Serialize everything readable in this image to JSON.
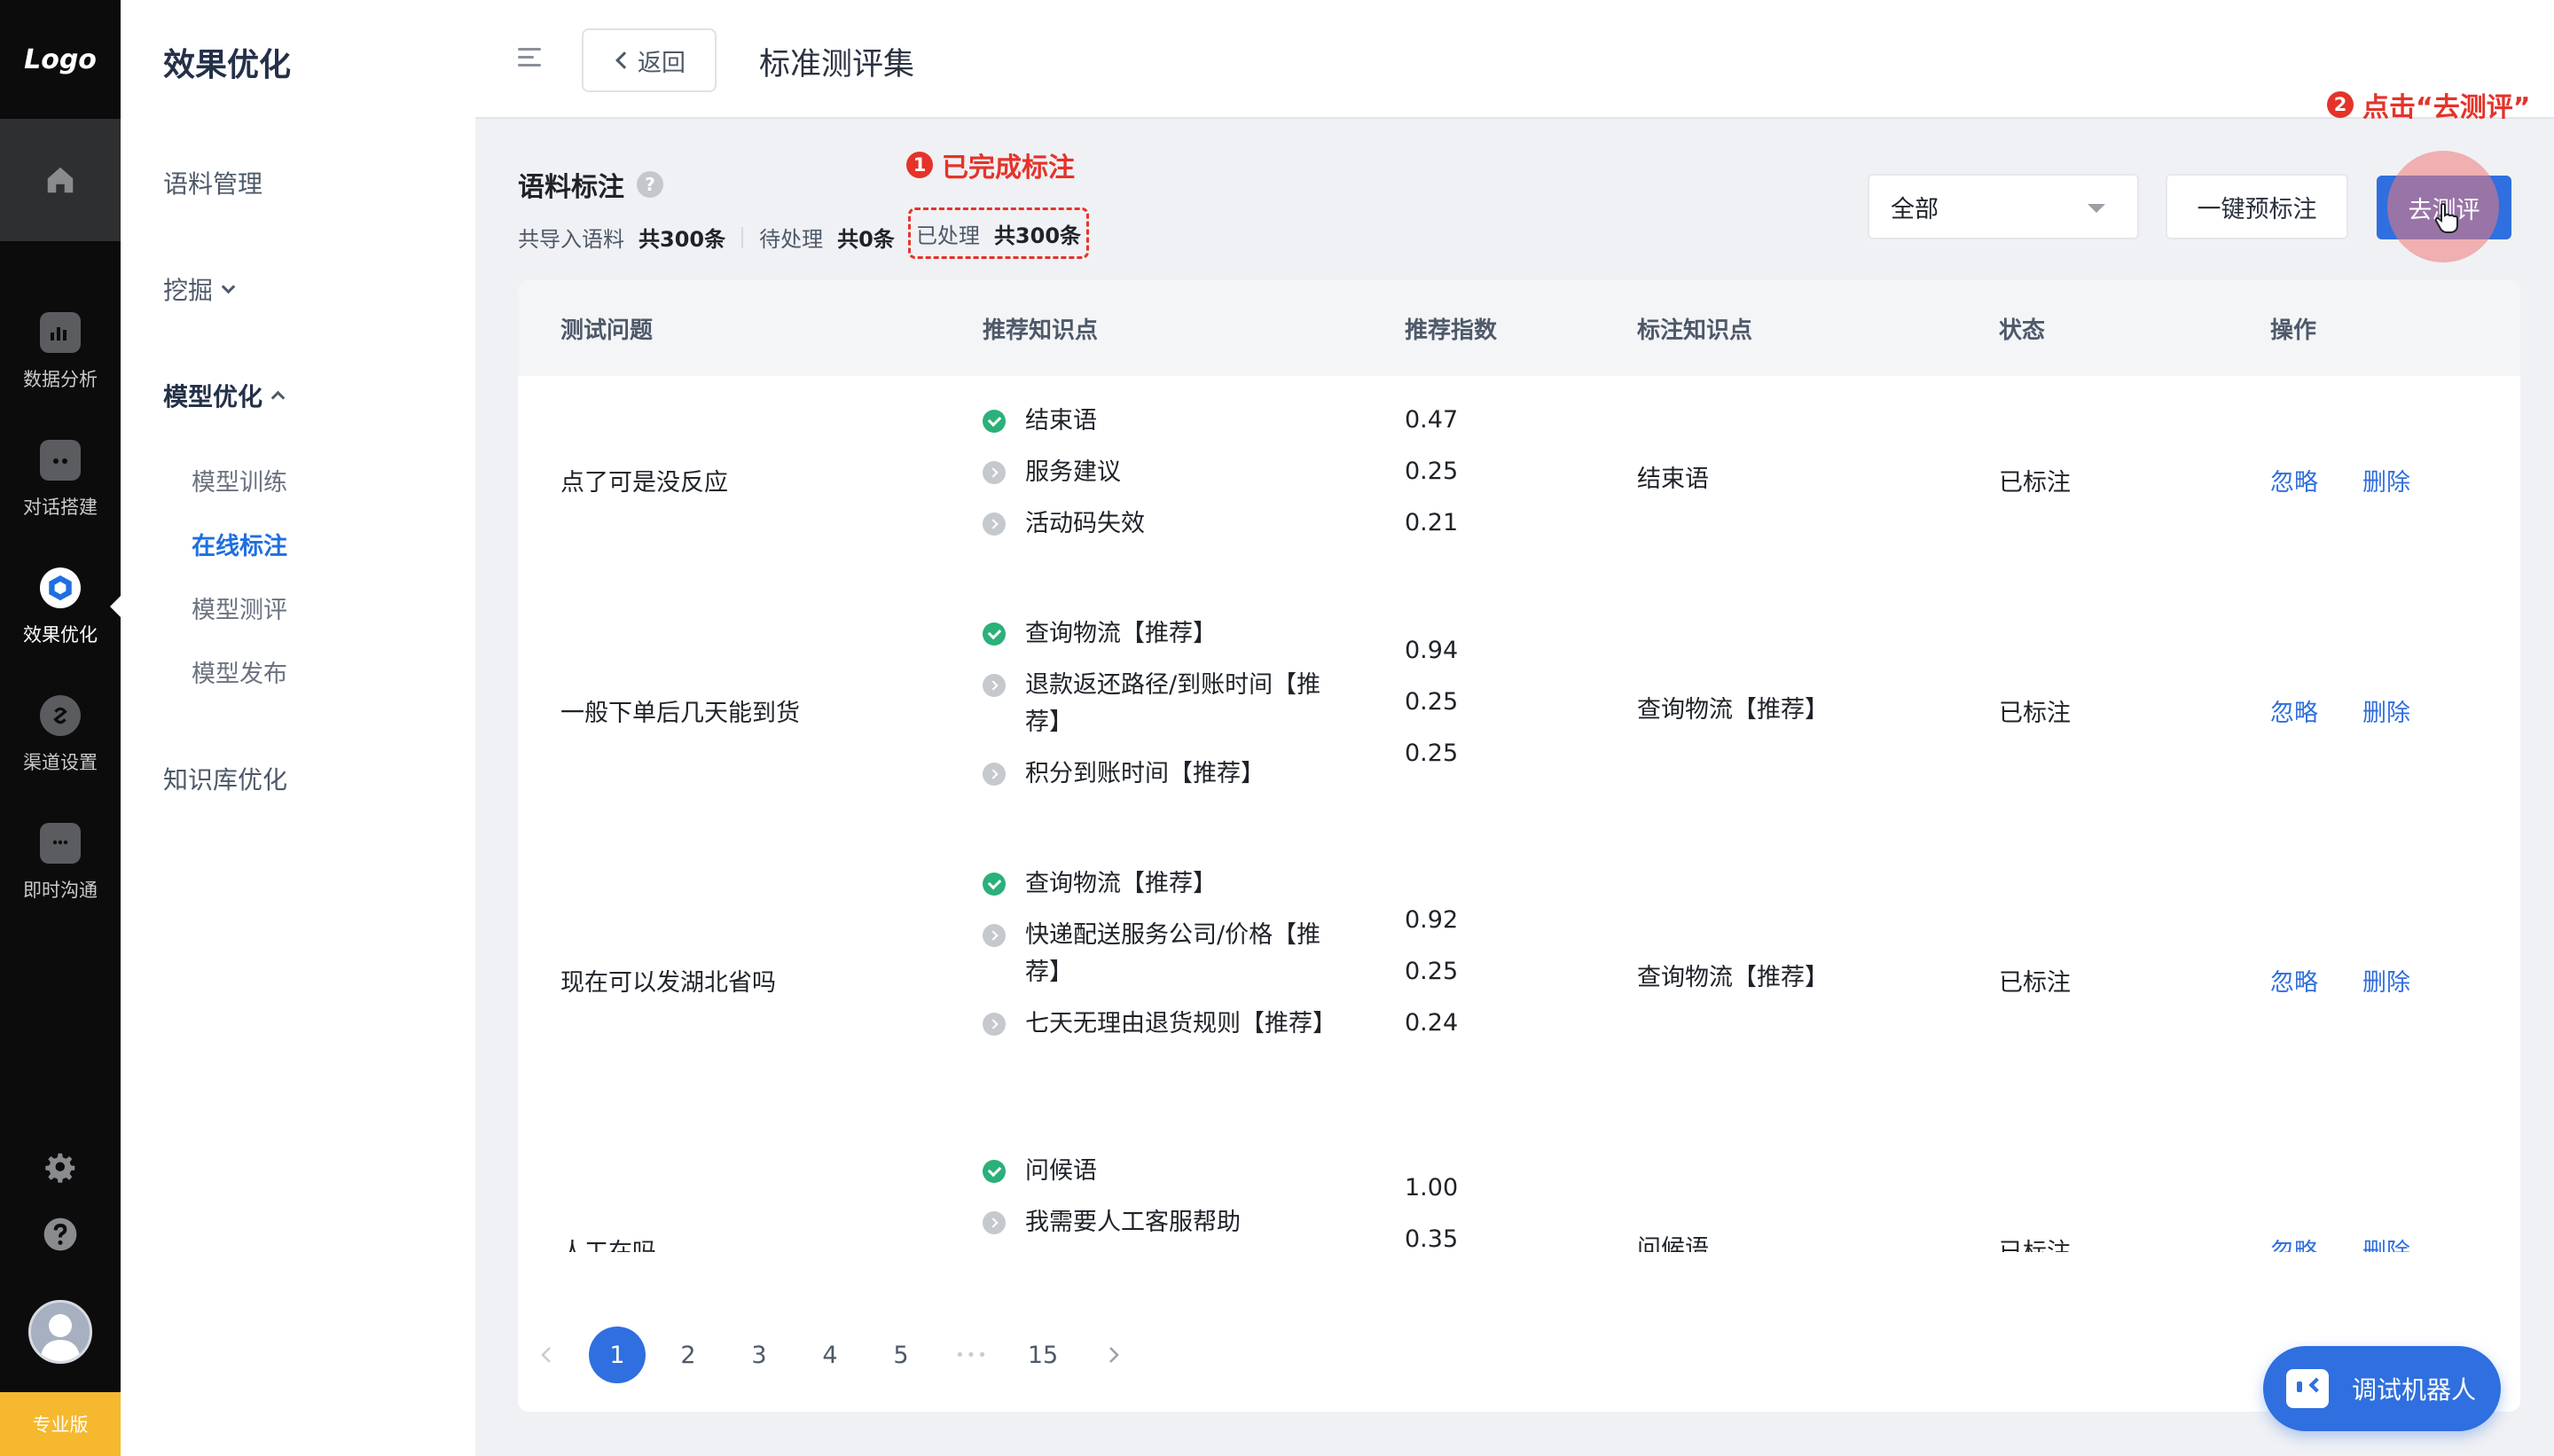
{
  "rail": {
    "logo": "Logo",
    "items": [
      {
        "label": "数据分析",
        "icon": "bar-chart-icon"
      },
      {
        "label": "对话搭建",
        "icon": "robot-icon"
      },
      {
        "label": "效果优化",
        "icon": "cube-icon",
        "active": true
      },
      {
        "label": "渠道设置",
        "icon": "channel-icon"
      },
      {
        "label": "即时沟通",
        "icon": "chat-bubble-icon"
      }
    ],
    "badge": "专业版"
  },
  "sidebar": {
    "title": "效果优化",
    "items": [
      "语料管理",
      "挖掘",
      "模型优化",
      "知识库优化"
    ],
    "sub_items": [
      "模型训练",
      "在线标注",
      "模型测评",
      "模型发布"
    ],
    "active_sub": "在线标注"
  },
  "topbar": {
    "back_label": "返回",
    "page_title": "标准测评集"
  },
  "section": {
    "title": "语料标注",
    "stats": {
      "imported_label": "共导入语料",
      "imported_value": "共300条",
      "pending_label": "待处理",
      "pending_value": "共0条",
      "processed_label": "已处理",
      "processed_value": "共300条"
    },
    "annotation_1_num": "1",
    "annotation_1": "已完成标注",
    "annotation_2_num": "2",
    "annotation_2": "点击“去测评”"
  },
  "toolbar": {
    "filter_value": "全部",
    "prelabel_label": "一键预标注",
    "evaluate_label": "去测评"
  },
  "table": {
    "headers": [
      "测试问题",
      "推荐知识点",
      "推荐指数",
      "标注知识点",
      "状态",
      "操作"
    ],
    "rows": [
      {
        "question": "点了可是没反应",
        "recommendations": [
          {
            "text": "结束语",
            "score": "0.47",
            "checked": true
          },
          {
            "text": "服务建议",
            "score": "0.25",
            "checked": false
          },
          {
            "text": "活动码失效",
            "score": "0.21",
            "checked": false
          }
        ],
        "labeled": "结束语",
        "status": "已标注",
        "ignore": "忽略",
        "delete": "删除"
      },
      {
        "question": "一般下单后几天能到货",
        "recommendations": [
          {
            "text": "查询物流【推荐】",
            "score": "0.94",
            "checked": true
          },
          {
            "text": "退款返还路径/到账时间【推荐】",
            "score": "0.25",
            "checked": false
          },
          {
            "text": "积分到账时间【推荐】",
            "score": "0.25",
            "checked": false
          }
        ],
        "labeled": "查询物流【推荐】",
        "status": "已标注",
        "ignore": "忽略",
        "delete": "删除"
      },
      {
        "question": "现在可以发湖北省吗",
        "recommendations": [
          {
            "text": "查询物流【推荐】",
            "score": "0.92",
            "checked": true
          },
          {
            "text": "快递配送服务公司/价格【推荐】",
            "score": "0.25",
            "checked": false
          },
          {
            "text": "七天无理由退货规则【推荐】",
            "score": "0.24",
            "checked": false
          }
        ],
        "labeled": "查询物流【推荐】",
        "status": "已标注",
        "ignore": "忽略",
        "delete": "删除"
      },
      {
        "question": "人工在吗",
        "recommendations": [
          {
            "text": "问候语",
            "score": "1.00",
            "checked": true
          },
          {
            "text": "我需要人工客服帮助",
            "score": "0.35",
            "checked": false
          }
        ],
        "labeled": "问候语",
        "status": "已标注",
        "ignore": "忽略",
        "delete": "删除"
      }
    ]
  },
  "pagination": {
    "pages": [
      "1",
      "2",
      "3",
      "4",
      "5"
    ],
    "ellipsis": "•••",
    "last": "15",
    "current": "1"
  },
  "bot_button": "调试机器人",
  "colors": {
    "accent": "#2f6fdf",
    "annotation_red": "#e5332a",
    "success": "#2bb07a",
    "badge": "#f5b82e"
  }
}
